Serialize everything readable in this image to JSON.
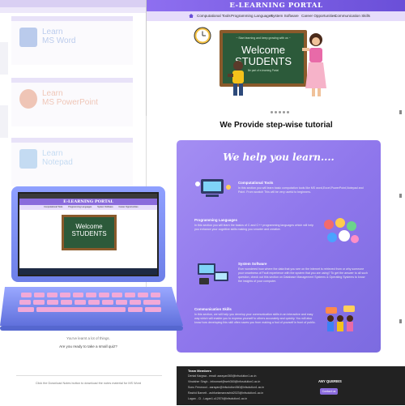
{
  "site": {
    "title": "E-LEARNING PORTAL",
    "nav": [
      "Computational Tools",
      "Programming Languages",
      "System Software",
      "Career Opportunities",
      "Communication Skills"
    ],
    "hero": {
      "top_line": "~ Start learning and keep growing with us ~",
      "headline_1": "Welcome",
      "headline_2": "STUDENTS",
      "bottom_line": "Be part of e-learning Portal"
    }
  },
  "background_cards": [
    {
      "label_1": "Learn",
      "label_2": "MS Word",
      "color": "#2b5fc6"
    },
    {
      "label_1": "Learn",
      "label_2": "MS PowerPoint",
      "color": "#d04e1f"
    },
    {
      "label_1": "Learn",
      "label_2": "Notepad",
      "color": "#4a90d9"
    }
  ],
  "section": {
    "heading": "We Provide step-wise tutorial",
    "panel_title": "We help you learn....",
    "features": [
      {
        "title": "Computational Tools",
        "desc": "In this section you will learn basic computation tools like MS word,Excel,PowerPoint,Notepad and Paint. From scratch This will be very useful to beginners."
      },
      {
        "title": "Programming Languages",
        "desc": "In this section you will learn the basics of C and C++ programming languages which will help you enhance your cognitive skills making you smarter and creative."
      },
      {
        "title": "System Software",
        "desc": "Ever wondered how where the data that you see on the internet is retrieved from or why someone your smartness of Fault experience with the system that you are using? To get the answer to all such question, check out this section on Database Management Systems & Operating Systems to know the insights of your computer."
      },
      {
        "title": "Communication Skills",
        "desc": "In this section, we will help you develop your communication skills in an interactive and easy way which will enable you to express yourself to others accurately and quickly. You will also know how developing this skill often saves you from making a fool of yourself in front of public."
      }
    ]
  },
  "footer": {
    "heading": "Team Members",
    "members": [
      "Dental Kargwa - email: aarayan360@infsolution1.ac.in",
      "Vinaisher Singh - infosmart@web360@infosolution1.ac.in",
      "Sonu Fenwood - aarayan@infsolution360@infsolution1.ac.in",
      "Rashid Barnett - ashfuelamanrashid2023@infsolution1.ac.in",
      "Lagan - Cl - Lagan1.u12574@infsolution1.ac.in"
    ],
    "queries_heading": "ANY QUERIES",
    "contact_button": "Contact us"
  },
  "left_page": {
    "line_1": "You've learnt a lot of things.",
    "line_2": "Are you ready to take a small quiz?",
    "line_3": "Click the Download Notes button to download the notes material for MS Word"
  },
  "colors": {
    "accent": "#8a6bdc",
    "panel": "#8f77ec",
    "laptop_body": "#7f8ff5",
    "keys": "#f2a9d8"
  }
}
